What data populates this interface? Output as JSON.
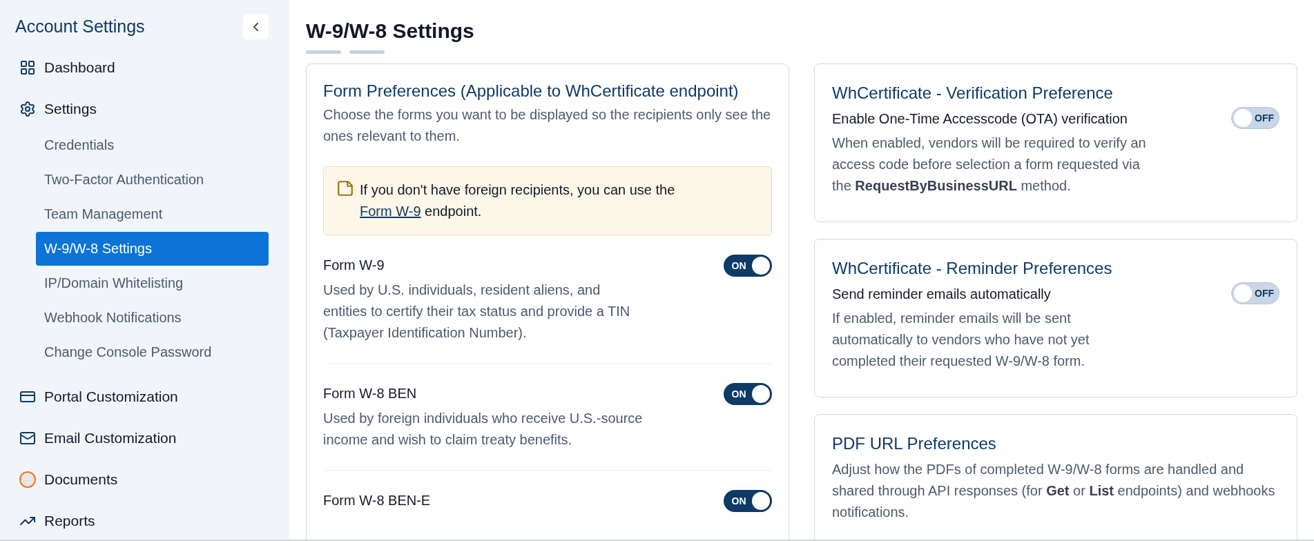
{
  "sidebar": {
    "title": "Account Settings",
    "items": [
      {
        "label": "Dashboard"
      },
      {
        "label": "Settings",
        "children": [
          {
            "label": "Credentials",
            "selected": false
          },
          {
            "label": "Two-Factor Authentication",
            "selected": false
          },
          {
            "label": "Team Management",
            "selected": false
          },
          {
            "label": "W-9/W-8 Settings",
            "selected": true
          },
          {
            "label": "IP/Domain Whitelisting",
            "selected": false
          },
          {
            "label": "Webhook Notifications",
            "selected": false
          },
          {
            "label": "Change Console Password",
            "selected": false
          }
        ]
      },
      {
        "label": "Portal Customization"
      },
      {
        "label": "Email Customization"
      },
      {
        "label": "Documents"
      },
      {
        "label": "Reports"
      }
    ]
  },
  "page_title": "W-9/W-8 Settings",
  "form_preferences": {
    "title": "Form Preferences (Applicable to WhCertificate endpoint)",
    "description": "Choose the forms you want to be displayed so the recipients only see the ones relevant to them.",
    "note": {
      "before": "If you don't have foreign recipients, you can use the",
      "link": "Form W-9",
      "after": "endpoint."
    },
    "forms": [
      {
        "name": "Form W-9",
        "description": "Used by U.S. individuals, resident aliens, and entities to certify their tax status and provide a TIN (Taxpayer Identification Number).",
        "on": true,
        "toggle_label": "ON"
      },
      {
        "name": "Form W-8 BEN",
        "description": "Used by foreign individuals who receive U.S.-source income and wish to claim treaty benefits.",
        "on": true,
        "toggle_label": "ON"
      },
      {
        "name": "Form W-8 BEN-E",
        "on": true,
        "toggle_label": "ON"
      }
    ]
  },
  "side_cards": [
    {
      "title": "WhCertificate - Verification Preference",
      "setting": "Enable One-Time Accesscode (OTA) verification",
      "description": "When enabled, vendors will be required to verify an access code before selection a form requested via the **RequestByBusinessURL** method.",
      "on": false,
      "toggle_label": "OFF"
    },
    {
      "title": "WhCertificate - Reminder Preferences",
      "setting": "Send reminder emails automatically",
      "description": "If enabled, reminder emails will be sent automatically to vendors who have not yet completed their requested W-9/W-8 form.",
      "on": false,
      "toggle_label": "OFF"
    },
    {
      "title": "PDF URL Preferences",
      "description": "Adjust how the PDFs of completed W-9/W-8 forms are handled and shared through API responses (for **Get** or **List** endpoints) and webhooks notifications."
    }
  ]
}
